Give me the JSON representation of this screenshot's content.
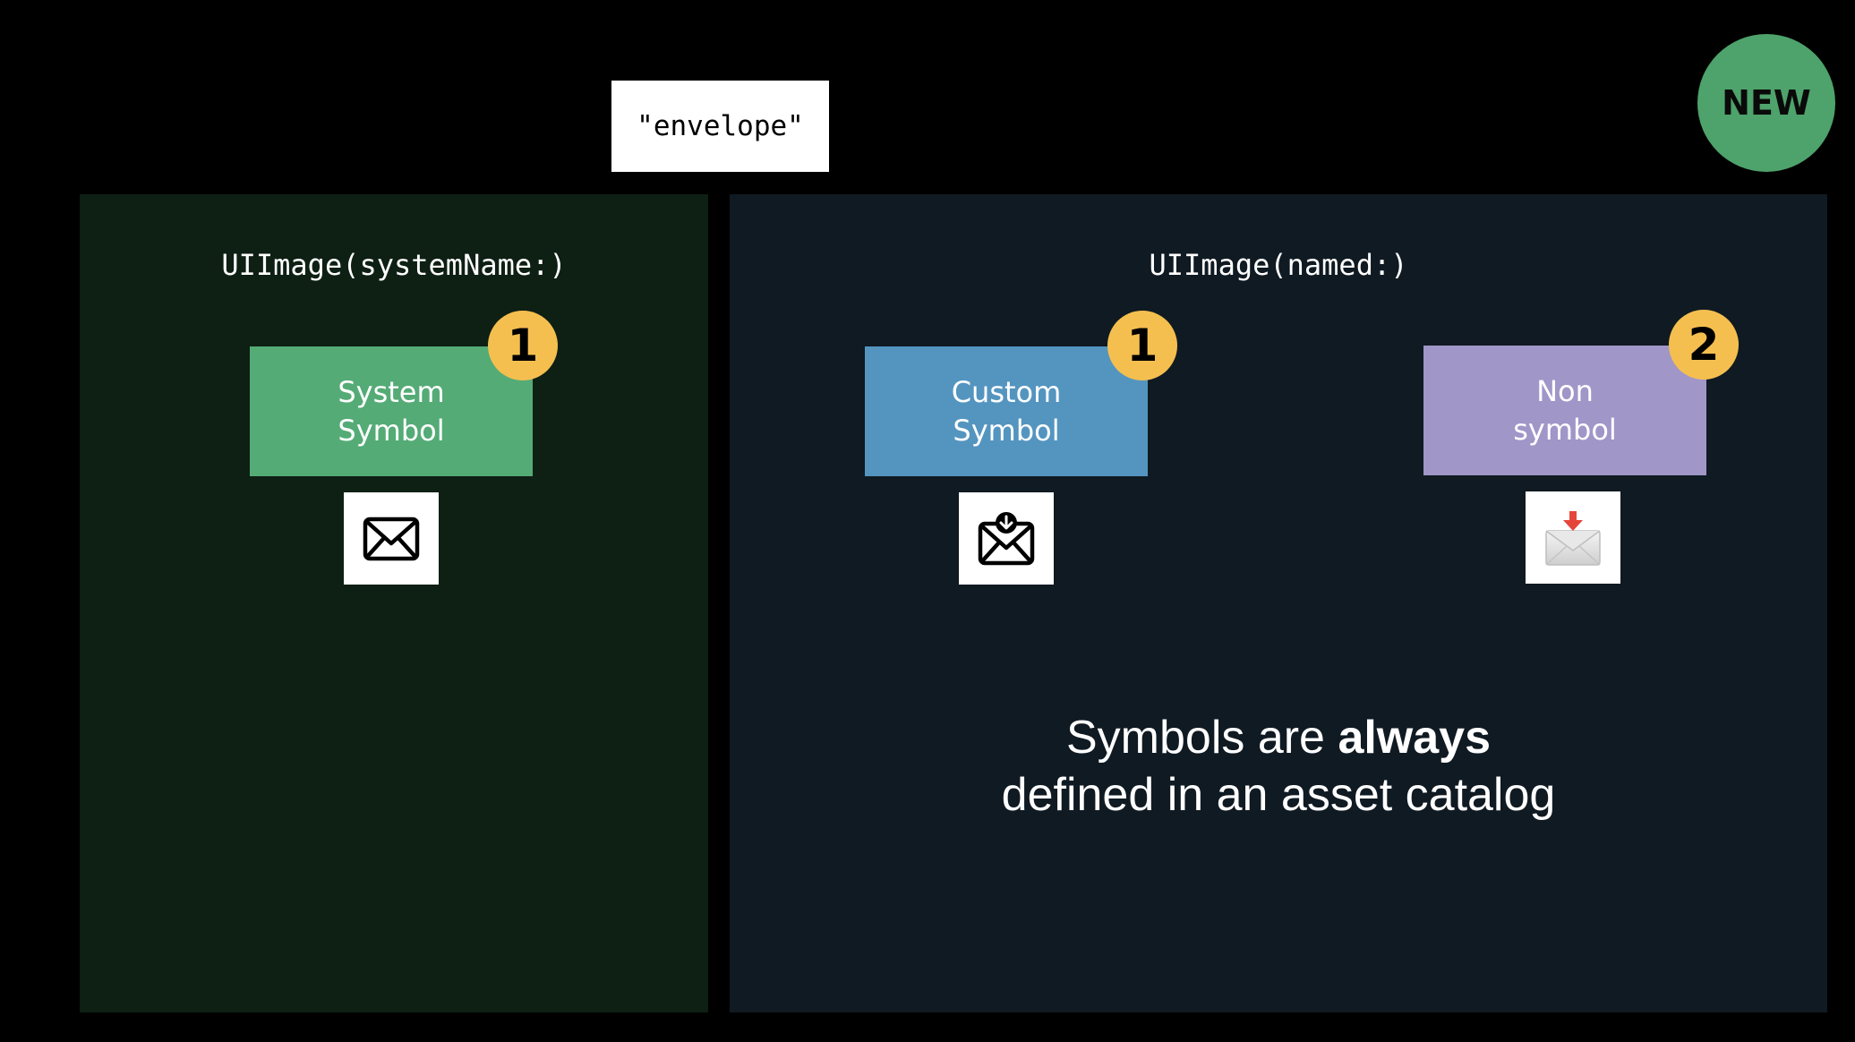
{
  "query": {
    "label": "\"envelope\""
  },
  "new_badge": {
    "label": "NEW",
    "color": "#4ea26b"
  },
  "left_panel": {
    "title": "UIImage(systemName:)",
    "background": "#0e1f14",
    "items": [
      {
        "label": "System\nSymbol",
        "color": "#54ab76",
        "badge": "1",
        "icon": "envelope-icon"
      }
    ]
  },
  "right_panel": {
    "title": "UIImage(named:)",
    "background": "#101a22",
    "items": [
      {
        "label": "Custom\nSymbol",
        "color": "#5495c0",
        "badge": "1",
        "icon": "envelope-download-icon"
      },
      {
        "label": "Non\nsymbol",
        "color": "#a096c8",
        "badge": "2",
        "icon": "incoming-envelope-emoji-icon"
      }
    ],
    "caption": {
      "line1_prefix": "Symbols are ",
      "line1_emphasis": "always",
      "line2": "defined in an asset catalog"
    }
  },
  "badge_color": "#f5bf4f"
}
